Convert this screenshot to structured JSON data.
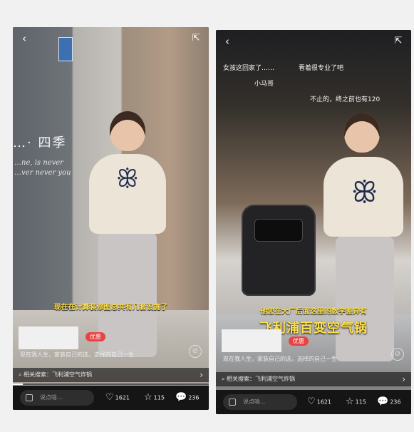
{
  "left": {
    "sign_text": "…· 四季",
    "sign_sub_1": "…ne, is never",
    "sign_sub_2": "…ver never you",
    "subtitle": "现在在计算装修图总共有几套设施了",
    "badge": "优惠",
    "caption": "现在我人生，家装自己的选，选择的自己一生",
    "search_text": "相关搜索：飞利浦空气炸锅",
    "progress": 0.05,
    "input_placeholder": "说点啥…",
    "likes": "1621",
    "favorites": "115",
    "comments": "236"
  },
  "right": {
    "floats": [
      "女孩这回家了……",
      "看着很专业了吧",
      "小马哥",
      "不止的，终之前也有120"
    ],
    "subtitle": "他您在大厂后面这里的数学差异有",
    "big_title": "飞利浦百变空气锅",
    "badge": "优惠",
    "caption": "现在我人生，家装自己的选，选择的自己一生",
    "search_text": "相关搜索：飞利浦空气炸锅",
    "input_placeholder": "说点啥…",
    "likes": "1621",
    "favorites": "115",
    "comments": "236"
  },
  "icons": {
    "back": "chevron-left",
    "share": "share-out",
    "mute": "mute",
    "like": "heart",
    "favorite": "star",
    "comment": "speech-bubble"
  },
  "colors": {
    "subtitle": "#ffe14b",
    "badge": "#e84242",
    "bow": "#1f2b4d"
  }
}
